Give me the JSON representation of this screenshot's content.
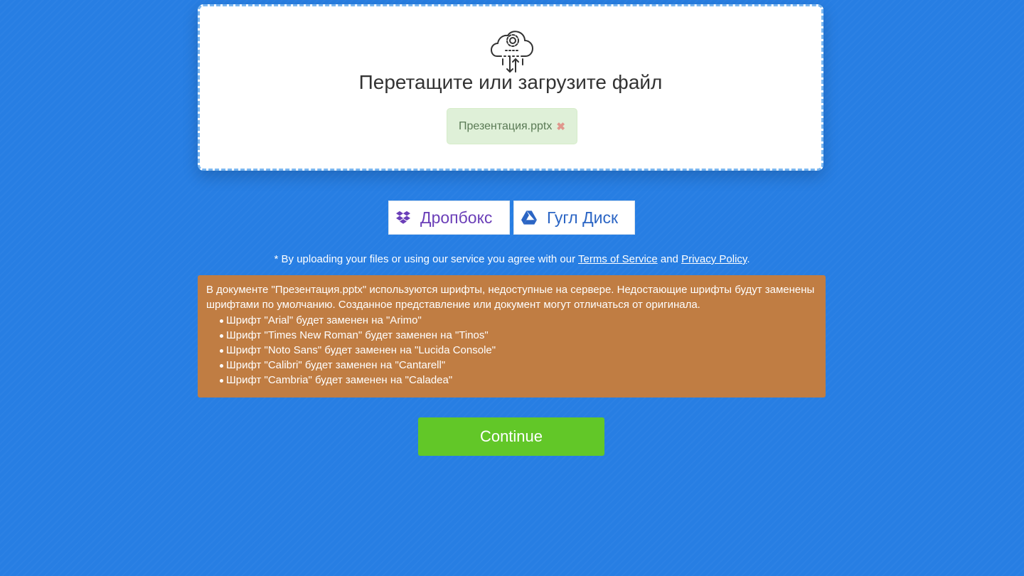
{
  "dropzone": {
    "title": "Перетащите или загрузите файл",
    "icon": "cloud-upload-gear-icon",
    "file": {
      "name": "Презентация.pptx",
      "remove_icon": "close-icon",
      "remove_glyph": "✖"
    }
  },
  "cloud_buttons": {
    "dropbox": {
      "label": "Дропбокс",
      "icon": "dropbox-icon"
    },
    "gdrive": {
      "label": "Гугл Диск",
      "icon": "google-drive-icon"
    }
  },
  "agreement": {
    "prefix": "* By uploading your files or using our service you agree with our ",
    "terms_link": "Terms of Service",
    "middle": " and ",
    "privacy_link": "Privacy Policy",
    "suffix": "."
  },
  "warning": {
    "message": "В документе \"Презентация.pptx\" используются шрифты, недоступные на сервере. Недостающие шрифты будут заменены шрифтами по умолчанию. Созданное представление или документ могут отличаться от оригинала.",
    "items": [
      "Шрифт \"Arial\" будет заменен на \"Arimo\"",
      "Шрифт \"Times New Roman\" будет заменен на \"Tinos\"",
      "Шрифт \"Noto Sans\" будет заменен на \"Lucida Console\"",
      "Шрифт \"Calibri\" будет заменен на \"Cantarell\"",
      "Шрифт \"Cambria\" будет заменен на \"Caladea\""
    ]
  },
  "continue_button": {
    "label": "Continue"
  },
  "colors": {
    "background": "#277ee3",
    "dropzone_border": "#79b6f0",
    "file_chip": "#dff0d8",
    "warning": "#c07d43",
    "continue": "#62c728",
    "dropbox_text": "#6b3fb8",
    "gdrive_text": "#2b65c4"
  }
}
